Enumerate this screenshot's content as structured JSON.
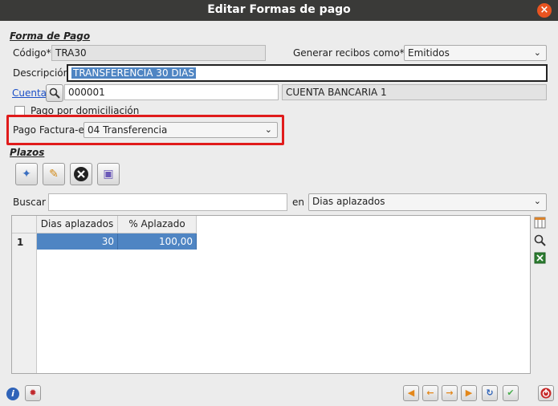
{
  "window": {
    "title": "Editar Formas de pago"
  },
  "forma_pago": {
    "section_title": "Forma de Pago",
    "codigo_label": "Código*",
    "codigo_value": "TRA30",
    "generar_label": "Generar recibos como*",
    "generar_value": "Emitidos",
    "descripcion_label": "Descripción",
    "descripcion_value": "TRANSFERENCIA 30 DIAS",
    "cuenta_label": "Cuenta",
    "cuenta_code": "000001",
    "cuenta_name": "CUENTA BANCARIA 1",
    "domiciliacion_label": "Pago por domiciliación",
    "factura_label": "Pago Factura-e",
    "factura_value": "04 Transferencia"
  },
  "plazos": {
    "section_title": "Plazos",
    "buscar_label": "Buscar",
    "buscar_value": "",
    "en_label": "en",
    "en_value": "Dias aplazados",
    "columns": [
      "Dias aplazados",
      "% Aplazado"
    ],
    "rows": [
      {
        "num": "1",
        "dias": "30",
        "aplazado": "100,00"
      }
    ]
  },
  "colors": {
    "highlight": "#e01b1b",
    "selection": "#4f85c3",
    "titlebar": "#3a3a38"
  }
}
